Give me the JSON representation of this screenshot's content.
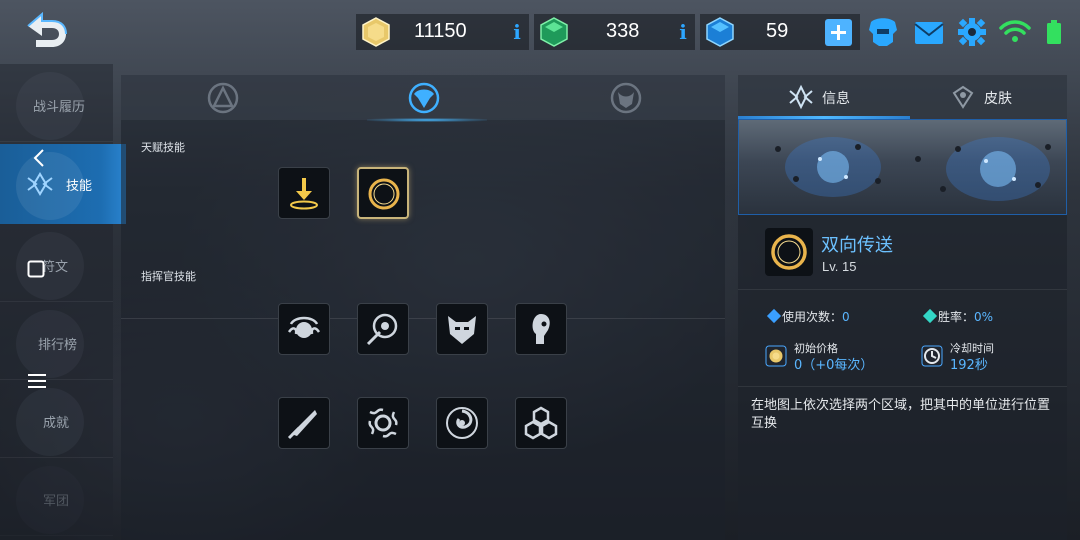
{
  "resources": {
    "gold": {
      "value": "11150",
      "info": "i",
      "icon": "gold-crystal-icon",
      "color": "#e8c86a"
    },
    "green": {
      "value": "338",
      "info": "i",
      "icon": "green-gem-icon",
      "color": "#3fd27a"
    },
    "blue": {
      "value": "59",
      "icon": "blue-gem-icon",
      "color": "#2aa8ff"
    }
  },
  "top_icons": [
    "helmet-icon",
    "mail-icon",
    "settings-gear-icon",
    "wifi-icon",
    "battery-icon"
  ],
  "sidebar": {
    "items": [
      {
        "label": "战斗履历"
      },
      {
        "label": "技能",
        "active": true
      },
      {
        "label": "符文"
      },
      {
        "label": "排行榜"
      },
      {
        "label": "成就"
      },
      {
        "label": "军团"
      }
    ]
  },
  "middle": {
    "tabs": [
      "faction-a-icon",
      "faction-b-icon",
      "faction-c-icon"
    ],
    "active_tab": 1,
    "talent_label": "天赋技能",
    "commander_label": "指挥官技能",
    "talent_skills": [
      "drop-skill-icon",
      "ring-portal-skill-icon"
    ],
    "commander_skills_row1": [
      "medusa-skill-icon",
      "lock-target-skill-icon",
      "mask-skill-icon",
      "alien-skill-icon"
    ],
    "commander_skills_row2": [
      "blade-skill-icon",
      "swirl-orb-skill-icon",
      "vortex-skill-icon",
      "hex-shield-skill-icon"
    ]
  },
  "right": {
    "tab_info": "信息",
    "tab_skin": "皮肤",
    "skill_name": "双向传送",
    "skill_level": "Lv. 15",
    "uses_label": "使用次数：",
    "uses_value": "0",
    "winrate_label": "胜率：",
    "winrate_value": "0%",
    "price_label": "初始价格",
    "price_value": "0（+0每次）",
    "cooldown_label": "冷却时间",
    "cooldown_value": "192秒",
    "description": "在地图上依次选择两个区域，把其中的单位进行位置互换"
  }
}
